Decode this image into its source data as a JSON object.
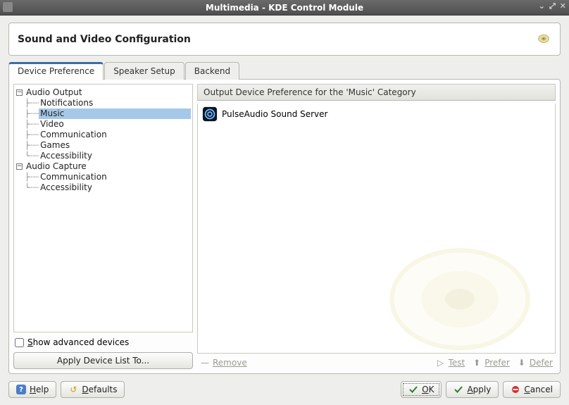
{
  "window_title": "Multimedia - KDE Control Module",
  "header_title": "Sound and Video Configuration",
  "tabs": [
    {
      "label": "Device Preference",
      "active": true
    },
    {
      "label": "Speaker Setup",
      "active": false
    },
    {
      "label": "Backend",
      "active": false
    }
  ],
  "tree": {
    "groups": [
      {
        "label": "Audio Output",
        "children": [
          {
            "label": "Notifications",
            "selected": false
          },
          {
            "label": "Music",
            "selected": true
          },
          {
            "label": "Video",
            "selected": false
          },
          {
            "label": "Communication",
            "selected": false
          },
          {
            "label": "Games",
            "selected": false
          },
          {
            "label": "Accessibility",
            "selected": false
          }
        ]
      },
      {
        "label": "Audio Capture",
        "children": [
          {
            "label": "Communication",
            "selected": false
          },
          {
            "label": "Accessibility",
            "selected": false
          }
        ]
      }
    ]
  },
  "show_advanced_label": "Show advanced devices",
  "apply_list_label": "Apply Device List To...",
  "output_header": "Output Device Preference for the 'Music' Category",
  "devices": [
    {
      "label": "PulseAudio Sound Server"
    }
  ],
  "actions": {
    "remove": "Remove",
    "test": "Test",
    "prefer": "Prefer",
    "defer": "Defer"
  },
  "footer": {
    "help": "Help",
    "defaults": "Defaults",
    "ok": "OK",
    "apply": "Apply",
    "cancel": "Cancel"
  }
}
